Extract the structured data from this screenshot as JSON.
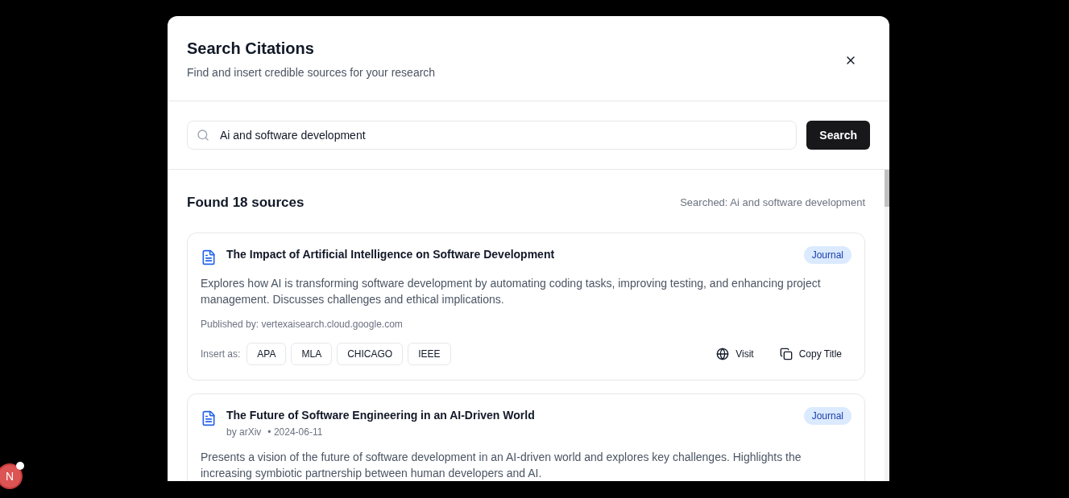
{
  "dialog": {
    "title": "Search Citations",
    "subtitle": "Find and insert credible sources for your research"
  },
  "search": {
    "value": "Ai and software development",
    "button": "Search"
  },
  "results": {
    "count_label": "Found 18 sources",
    "searched_label": "Searched: Ai and software development",
    "items": [
      {
        "title": "The Impact of Artificial Intelligence on Software Development",
        "tag": "Journal",
        "description": "Explores how AI is transforming software development by automating coding tasks, improving testing, and enhancing project management. Discusses challenges and ethical implications.",
        "publisher": "Published by: vertexaisearch.cloud.google.com",
        "insert_label": "Insert as:",
        "formats": [
          "APA",
          "MLA",
          "CHICAGO",
          "IEEE"
        ],
        "actions": [
          {
            "kind": "visit",
            "label": "Visit"
          },
          {
            "kind": "copy",
            "label": "Copy Title"
          }
        ]
      },
      {
        "title": "The Future of Software Engineering in an AI-Driven World",
        "tag": "Journal",
        "author": "by arXiv",
        "date": "• 2024-06-11",
        "description": "Presents a vision of the future of software development in an AI-driven world and explores key challenges. Highlights the increasing symbiotic partnership between human developers and AI."
      }
    ]
  },
  "dev_badge": {
    "letter": "N"
  }
}
